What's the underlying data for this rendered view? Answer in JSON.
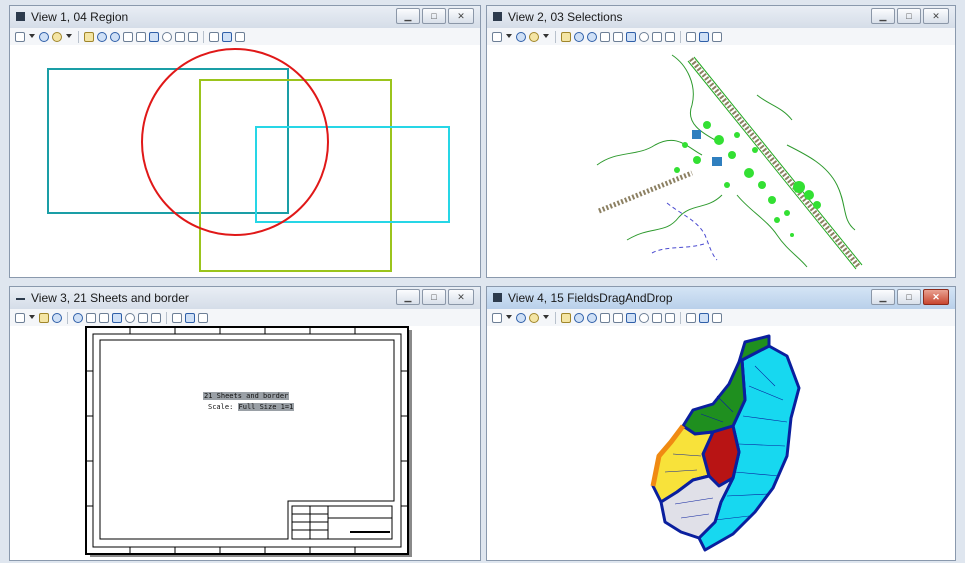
{
  "views": [
    {
      "title": "View 1, 04 Region"
    },
    {
      "title": "View 2, 03 Selections"
    },
    {
      "title": "View 3, 21 Sheets and border"
    },
    {
      "title": "View 4, 15 FieldsDragAndDrop"
    }
  ],
  "sheet": {
    "title": "21 Sheets and border",
    "scale_label": "Scale:",
    "scale_value": "Full Size 1=1"
  }
}
